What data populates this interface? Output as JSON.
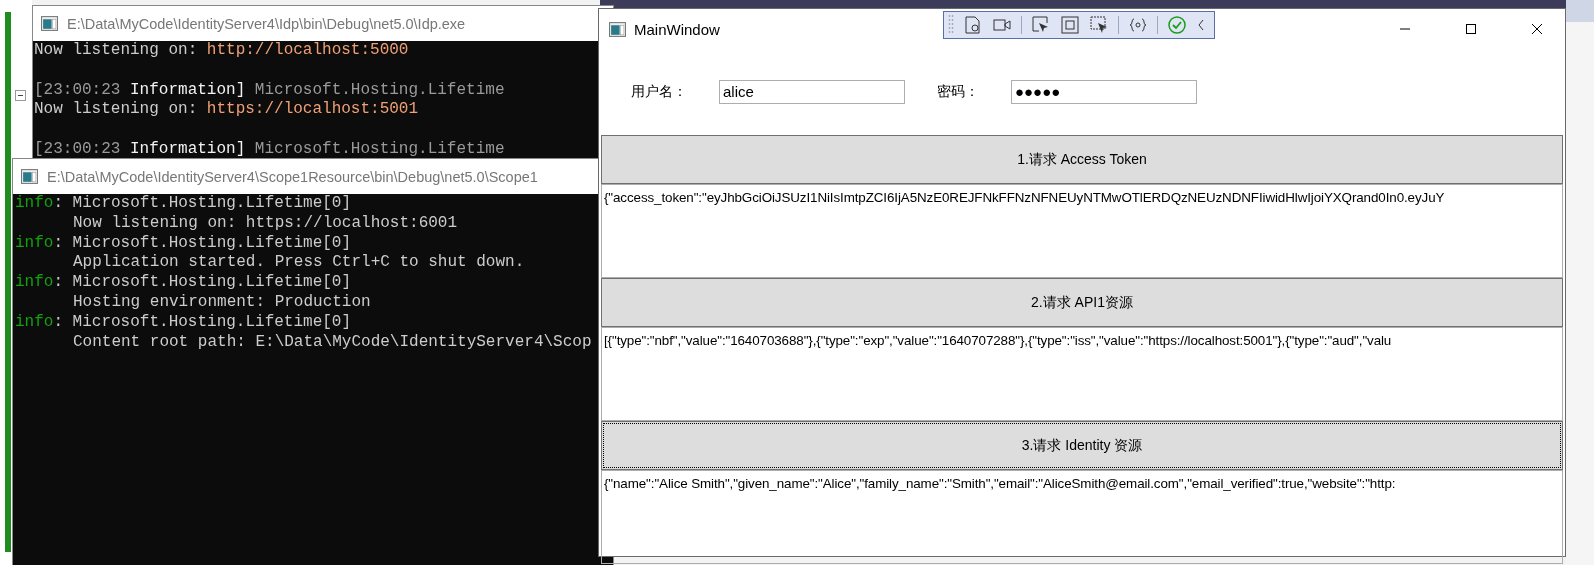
{
  "consoles": [
    {
      "title": "E:\\Data\\MyCode\\IdentityServer4\\Idp\\bin\\Debug\\net5.0\\Idp.exe",
      "active": false,
      "lines": [
        {
          "kind": "text",
          "segments": [
            {
              "kind": "plain",
              "text": "Now listening on: "
            },
            {
              "kind": "url",
              "text": "http://localhost:5000"
            }
          ]
        },
        {
          "kind": "blank"
        },
        {
          "kind": "text",
          "segments": [
            {
              "kind": "dim",
              "text": "[23:00:23 "
            },
            {
              "kind": "bright",
              "text": "Information]"
            },
            {
              "kind": "dim",
              "text": " Microsoft.Hosting.Lifetime"
            }
          ]
        },
        {
          "kind": "text",
          "segments": [
            {
              "kind": "plain",
              "text": "Now listening on: "
            },
            {
              "kind": "url",
              "text": "https://localhost:5001"
            }
          ]
        },
        {
          "kind": "blank"
        },
        {
          "kind": "text",
          "segments": [
            {
              "kind": "dim",
              "text": "[23:00:23 "
            },
            {
              "kind": "bright",
              "text": "Information]"
            },
            {
              "kind": "dim",
              "text": " Microsoft.Hosting.Lifetime"
            }
          ]
        }
      ]
    },
    {
      "title": "E:\\Data\\MyCode\\IdentityServer4\\Scope1Resource\\bin\\Debug\\net5.0\\Scope1",
      "active": false,
      "lines": [
        {
          "kind": "text",
          "segments": [
            {
              "kind": "info",
              "text": "info"
            },
            {
              "kind": "plain",
              "text": ": Microsoft.Hosting.Lifetime[0]"
            }
          ]
        },
        {
          "kind": "indented",
          "segments": [
            {
              "kind": "plain",
              "text": "Now listening on: https://localhost:6001"
            }
          ]
        },
        {
          "kind": "text",
          "segments": [
            {
              "kind": "info",
              "text": "info"
            },
            {
              "kind": "plain",
              "text": ": Microsoft.Hosting.Lifetime[0]"
            }
          ]
        },
        {
          "kind": "indented",
          "segments": [
            {
              "kind": "plain",
              "text": "Application started. Press Ctrl+C to shut down."
            }
          ]
        },
        {
          "kind": "text",
          "segments": [
            {
              "kind": "info",
              "text": "info"
            },
            {
              "kind": "plain",
              "text": ": Microsoft.Hosting.Lifetime[0]"
            }
          ]
        },
        {
          "kind": "indented",
          "segments": [
            {
              "kind": "plain",
              "text": "Hosting environment: Production"
            }
          ]
        },
        {
          "kind": "text",
          "segments": [
            {
              "kind": "info",
              "text": "info"
            },
            {
              "kind": "plain",
              "text": ": Microsoft.Hosting.Lifetime[0]"
            }
          ]
        },
        {
          "kind": "indented",
          "segments": [
            {
              "kind": "plain",
              "text": "Content root path: E:\\Data\\MyCode\\IdentityServer4\\Scop"
            }
          ]
        }
      ]
    }
  ],
  "main_window": {
    "title": "MainWindow",
    "username": {
      "label": "用户名：",
      "value": "alice"
    },
    "password": {
      "label": "密码：",
      "value": "●●●●●"
    },
    "sections": [
      {
        "button": "1.请求 Access Token",
        "focused": false,
        "output": "{\"access_token\":\"eyJhbGciOiJSUzI1NiIsImtpZCI6IjA5NzE0REJFNkFFNzNFNEUyNTMwOTlERDQzNEUzNDNFIiwidHlwIjoiYXQrand0In0.eyJuY"
      },
      {
        "button": "2.请求 API1资源",
        "focused": false,
        "output": "[{\"type\":\"nbf\",\"value\":\"1640703688\"},{\"type\":\"exp\",\"value\":\"1640707288\"},{\"type\":\"iss\",\"value\":\"https://localhost:5001\"},{\"type\":\"aud\",\"valu"
      },
      {
        "button": "3.请求 Identity 资源",
        "focused": true,
        "output": "{\"name\":\"Alice Smith\",\"given_name\":\"Alice\",\"family_name\":\"Smith\",\"email\":\"AliceSmith@email.com\",\"email_verified\":true,\"website\":\"http:"
      }
    ]
  }
}
